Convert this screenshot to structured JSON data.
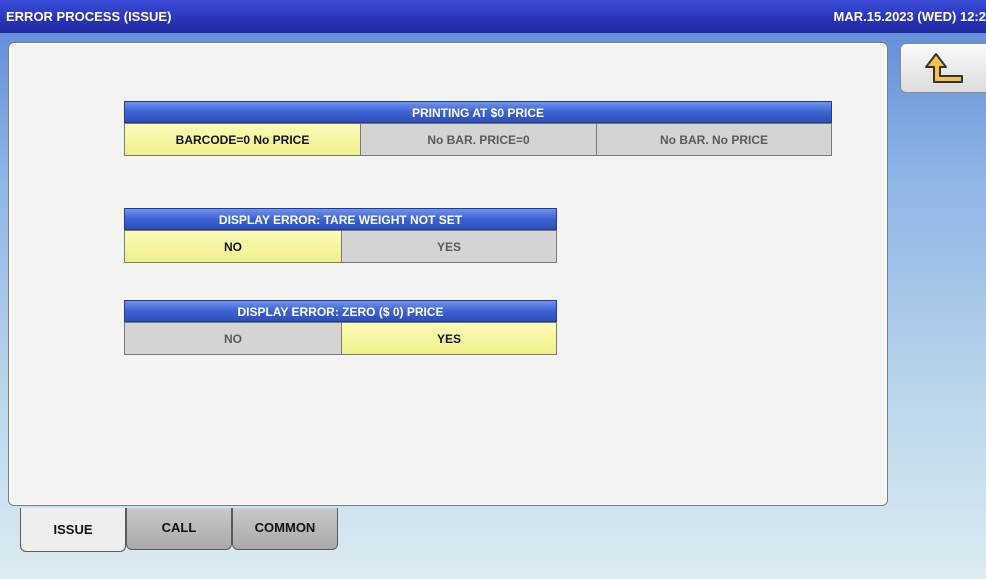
{
  "header": {
    "title": "ERROR PROCESS (ISSUE)",
    "datetime": "MAR.15.2023 (WED)  12:2"
  },
  "back_button": {
    "icon": "return-arrow-icon"
  },
  "groups": [
    {
      "title": "PRINTING AT $0 PRICE",
      "options": [
        "BARCODE=0 No PRICE",
        "No BAR. PRICE=0",
        "No BAR. No PRICE"
      ],
      "selected": "BARCODE=0 No PRICE"
    },
    {
      "title": "DISPLAY ERROR: TARE WEIGHT NOT SET",
      "options": [
        "NO",
        "YES"
      ],
      "selected": "NO"
    },
    {
      "title": "DISPLAY ERROR: ZERO ($ 0) PRICE",
      "options": [
        "NO",
        "YES"
      ],
      "selected": "YES"
    }
  ],
  "tabs": [
    {
      "label": "ISSUE",
      "active": true
    },
    {
      "label": "CALL",
      "active": false
    },
    {
      "label": "COMMON",
      "active": false
    }
  ],
  "colors": {
    "selected": "#f4f49a",
    "unselected": "#d4d4d4",
    "header_blue": "#3e63d2",
    "titlebar": "#2a32b8"
  }
}
